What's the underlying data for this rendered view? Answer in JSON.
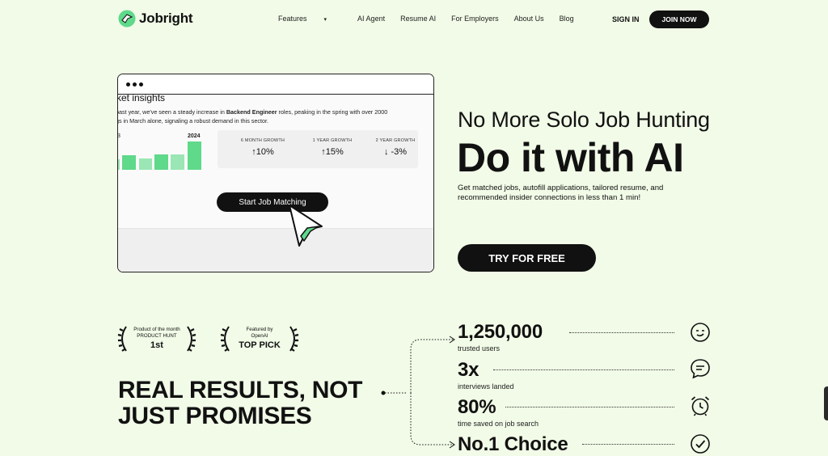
{
  "nav": {
    "brand": "Jobright",
    "links": [
      "Features",
      "AI Agent",
      "Resume AI",
      "For Employers",
      "About Us",
      "Blog"
    ],
    "features_caret": "▾",
    "sign_in": "SIGN IN",
    "join_now": "JOIN NOW"
  },
  "preview": {
    "title": "ket insights",
    "body_prefix": "past year, we've seen a steady increase in ",
    "body_bold": "Backend Engineer",
    "body_suffix": " roles, peaking in the spring with over 2000",
    "body_line2": "gs in March alone, signaling a robust demand in this sector.",
    "year_left": "3",
    "year_right": "2024",
    "growth": [
      {
        "label": "6 MONTH GROWTH",
        "value": "↑10%"
      },
      {
        "label": "1 YEAR GROWTH",
        "value": "↑15%"
      },
      {
        "label": "2 YEAR GROWTH",
        "value": "↓ -3%"
      }
    ],
    "cta": "Start Job Matching"
  },
  "hero": {
    "subhead": "No More Solo Job Hunting",
    "headline": "Do it with AI",
    "description": "Get matched jobs, autofill applications, tailored resume, and recommended insider connections in less than 1 min!",
    "cta": "TRY FOR FREE"
  },
  "awards": [
    {
      "line1": "Product of the month",
      "line2": "PRODUCT HUNT",
      "big": "1st"
    },
    {
      "line1": "Featured by",
      "line2": "OpenAI",
      "big": "TOP PICK"
    }
  ],
  "section_title_line1": "REAL RESULTS, NOT",
  "section_title_line2": "JUST PROMISES",
  "stats": [
    {
      "value": "1,250,000",
      "label": "trusted users",
      "icon": "smile-face-icon"
    },
    {
      "value": "3x",
      "label": "interviews landed",
      "icon": "chat-bubble-icon"
    },
    {
      "value": "80%",
      "label": "time saved on job search",
      "icon": "alarm-clock-icon"
    },
    {
      "value": "No.1 Choice",
      "label": "",
      "icon": "check-circle-icon"
    }
  ],
  "colors": {
    "background": "#f1fbe7",
    "accent_green": "#5fd98a",
    "dark": "#111111"
  }
}
